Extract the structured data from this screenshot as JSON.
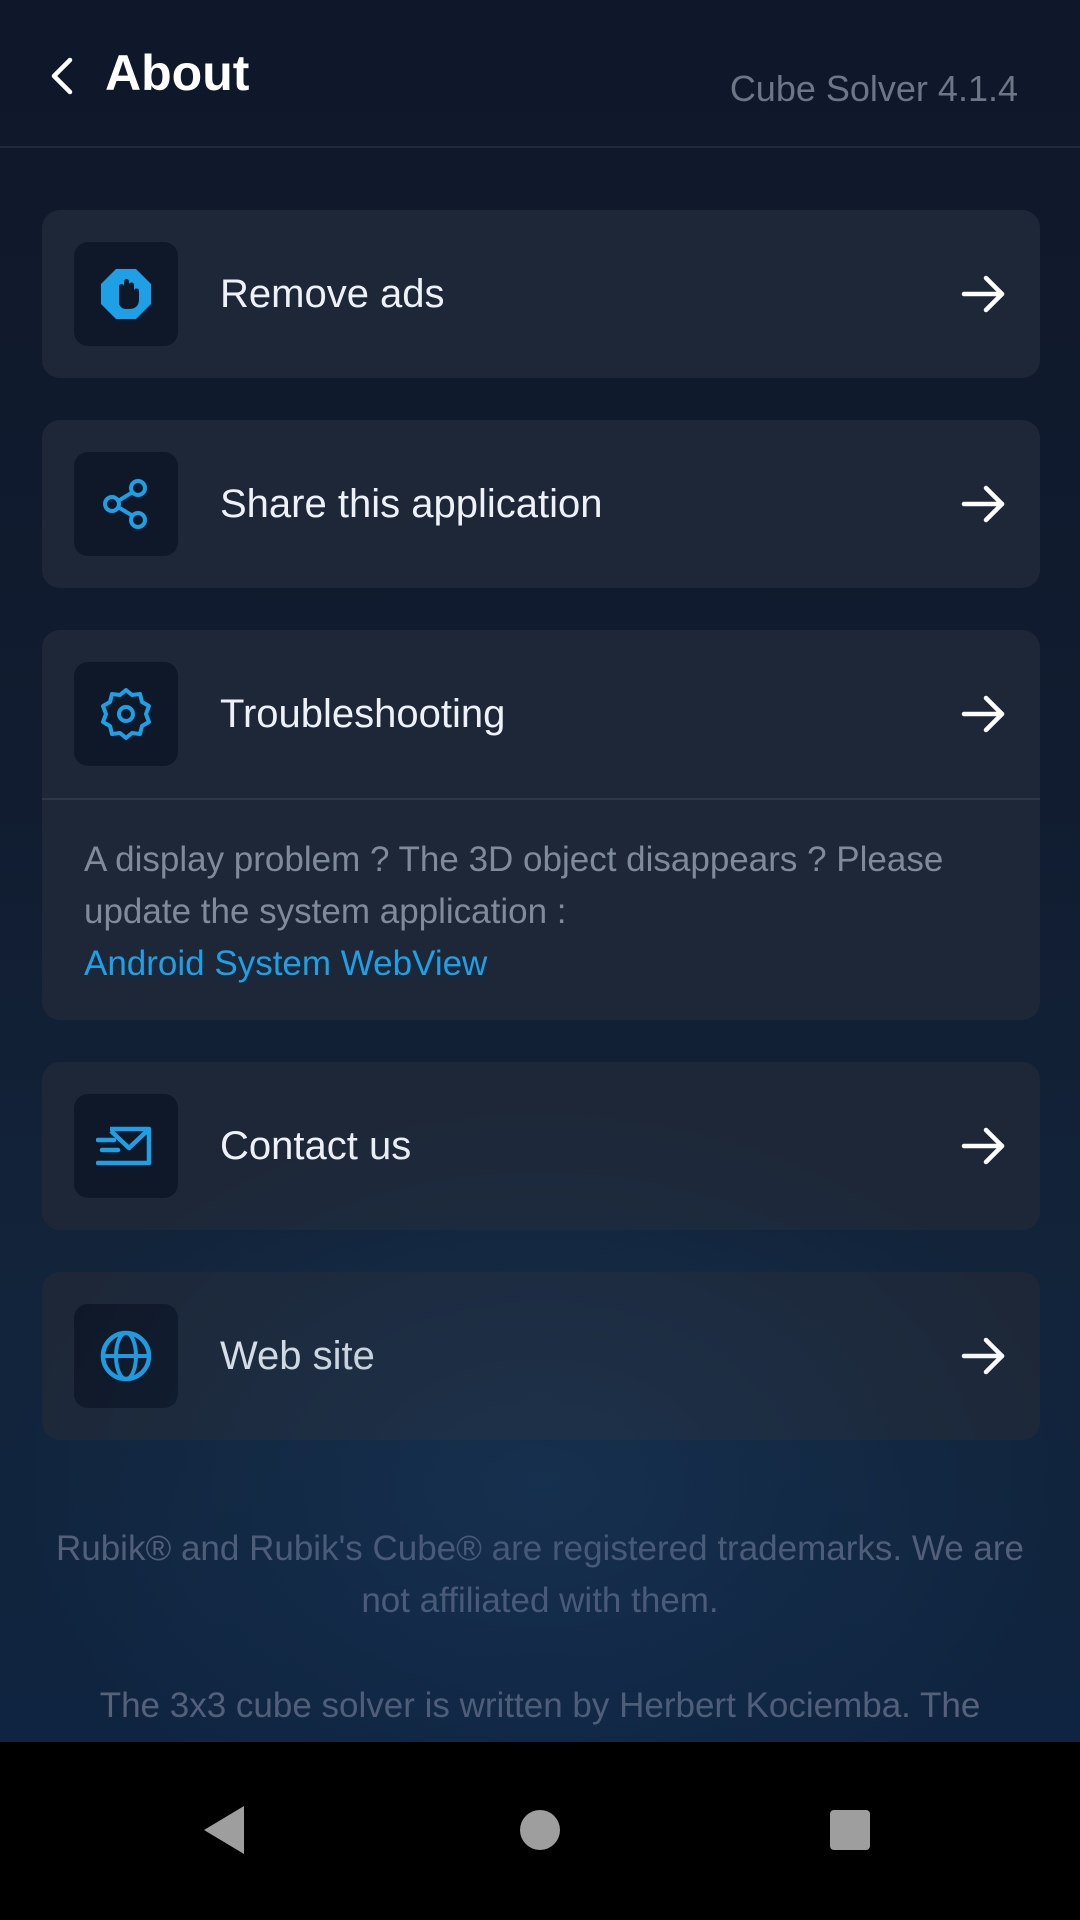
{
  "header": {
    "title": "About",
    "version": "Cube Solver 4.1.4"
  },
  "menu": {
    "remove_ads": "Remove ads",
    "share": "Share this application",
    "troubleshooting": "Troubleshooting",
    "troubleshooting_text": "A display problem ? The 3D object disappears ? Please update the system application :",
    "troubleshooting_link": "Android System WebView",
    "contact": "Contact us",
    "website": "Web site"
  },
  "footer": {
    "trademark": "Rubik® and Rubik's Cube® are registered trademarks. We are not affiliated with them.",
    "credits": "The 3x3 cube solver is written by Herbert Kociemba. The"
  },
  "colors": {
    "accent": "#1ea0e6",
    "card": "#1d2738",
    "background": "#111c30"
  },
  "icons": [
    "chevron-left-icon",
    "stop-hand-icon",
    "share-icon",
    "gear-icon",
    "mail-fast-icon",
    "globe-icon",
    "arrow-right-icon"
  ]
}
